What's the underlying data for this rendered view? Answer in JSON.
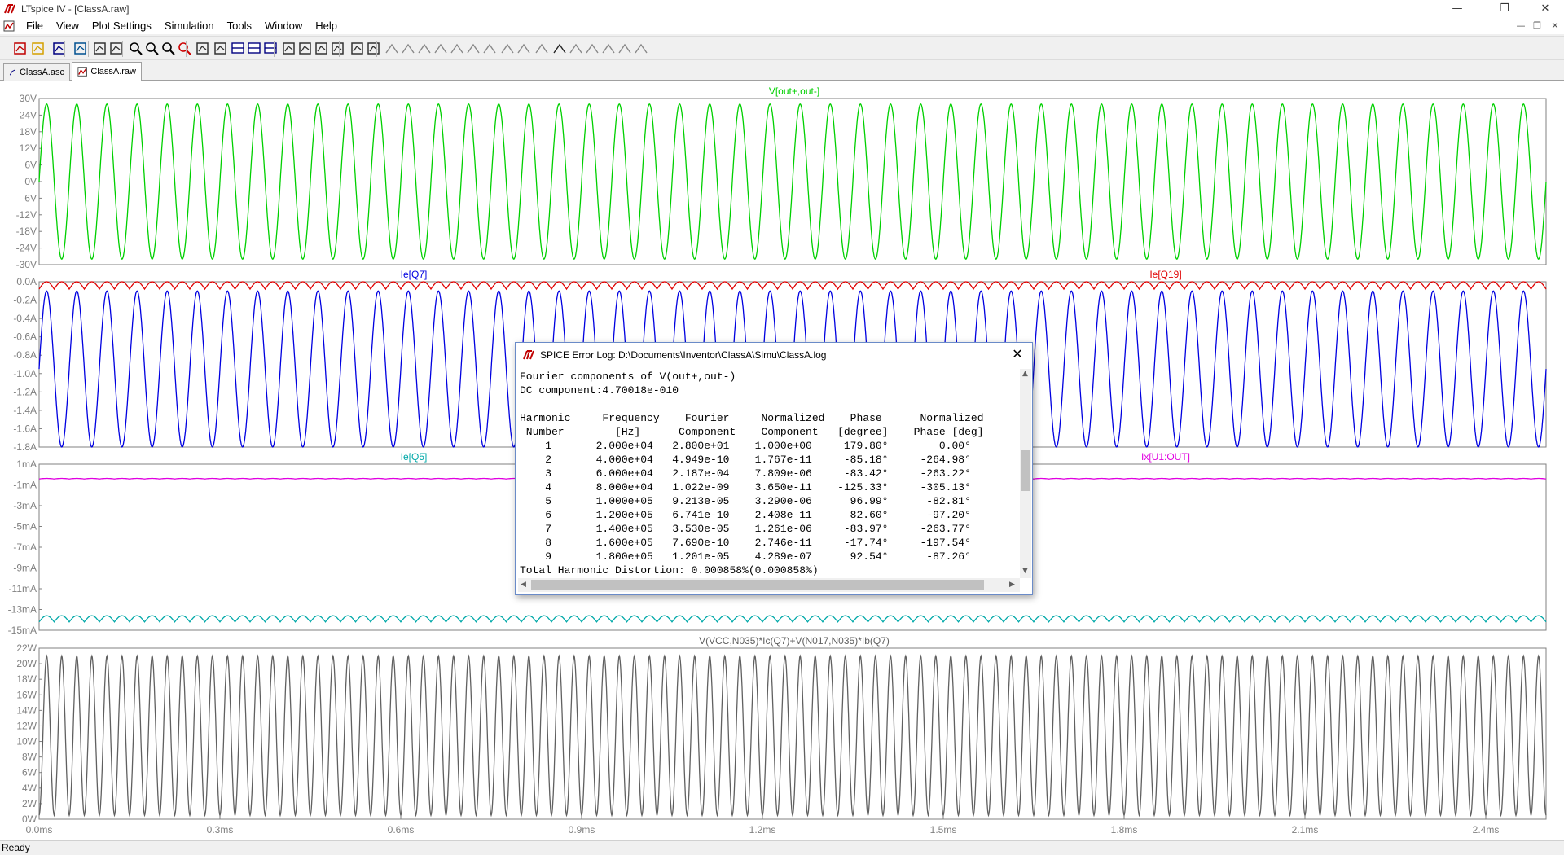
{
  "window": {
    "title": "LTspice IV - [ClassA.raw]"
  },
  "menu": [
    "File",
    "View",
    "Plot Settings",
    "Simulation",
    "Tools",
    "Window",
    "Help"
  ],
  "toolbar_icons": [
    "new-schematic-icon",
    "open-icon",
    "save-icon",
    "control-panel-icon",
    "run-icon",
    "halt-icon",
    "zoom-in-icon",
    "zoom-out-icon",
    "zoom-full-icon",
    "zoom-cancel-icon",
    "autorange-icon",
    "add-trace-icon",
    "tile-horizontal-icon",
    "tile-vertical-icon",
    "cascade-icon",
    "cut-icon",
    "copy-icon",
    "paste-icon",
    "find-icon",
    "print-preview-icon",
    "print-icon",
    "wire-icon",
    "ground-icon",
    "label-icon",
    "resistor-icon",
    "capacitor-icon",
    "inductor-icon",
    "diode-icon",
    "component-icon",
    "move-icon",
    "drag-icon",
    "undo-icon",
    "redo-icon",
    "rotate-icon",
    "mirror-icon",
    "text-icon",
    "spice-directive-icon"
  ],
  "tabs": [
    {
      "label": "ClassA.asc",
      "active": false
    },
    {
      "label": "ClassA.raw",
      "active": true
    }
  ],
  "chart_data": [
    {
      "type": "line",
      "series": [
        {
          "name": "V[out+,out-]",
          "color": "#00d000",
          "waveform": "sine",
          "amplitude": 28,
          "offset": 0,
          "frequency_hz": 20000
        }
      ],
      "yticks": [
        "30V",
        "24V",
        "18V",
        "12V",
        "6V",
        "0V",
        "-6V",
        "-12V",
        "-18V",
        "-24V",
        "-30V"
      ],
      "ylim": [
        -30,
        30
      ],
      "xlim": [
        0,
        2.5
      ],
      "grid": false
    },
    {
      "type": "line",
      "series": [
        {
          "name": "Ie[Q7]",
          "color": "#0000e0",
          "waveform": "sine",
          "amplitude": 0.85,
          "offset": -0.95,
          "frequency_hz": 20000
        },
        {
          "name": "Ie[Q19]",
          "color": "#e00000",
          "waveform": "rectified",
          "amplitude": 0.08,
          "offset": -0.04,
          "frequency_hz": 40000
        }
      ],
      "yticks": [
        "0.0A",
        "-0.2A",
        "-0.4A",
        "-0.6A",
        "-0.8A",
        "-1.0A",
        "-1.2A",
        "-1.4A",
        "-1.6A",
        "-1.8A"
      ],
      "ylim": [
        -1.8,
        0
      ],
      "xlim": [
        0,
        2.5
      ],
      "grid": false
    },
    {
      "type": "line",
      "series": [
        {
          "name": "Ie[Q5]",
          "color": "#00a8a8",
          "waveform": "ripple",
          "amplitude": 0.6,
          "offset": -13.9,
          "frequency_hz": 40000
        },
        {
          "name": "Ix[U1:OUT]",
          "color": "#e000e0",
          "waveform": "ripple",
          "amplitude": 0.05,
          "offset": -0.4,
          "frequency_hz": 40000
        }
      ],
      "yticks": [
        "1mA",
        "-1mA",
        "-3mA",
        "-5mA",
        "-7mA",
        "-9mA",
        "-11mA",
        "-13mA",
        "-15mA"
      ],
      "ylim": [
        -15,
        1
      ],
      "xlim": [
        0,
        2.5
      ],
      "grid": false
    },
    {
      "type": "line",
      "series": [
        {
          "name": "V(VCC,N035)*Ic(Q7)+V(N017,N035)*Ib(Q7)",
          "color": "#606060",
          "waveform": "power",
          "amplitude": 20.5,
          "offset": 0.5,
          "frequency_hz": 20000
        }
      ],
      "yticks": [
        "22W",
        "20W",
        "18W",
        "16W",
        "14W",
        "12W",
        "10W",
        "8W",
        "6W",
        "4W",
        "2W",
        "0W"
      ],
      "ylim": [
        0,
        22
      ],
      "xlim": [
        0,
        2.5
      ],
      "xticks": [
        "0.0ms",
        "0.3ms",
        "0.6ms",
        "0.9ms",
        "1.2ms",
        "1.5ms",
        "1.8ms",
        "2.1ms",
        "2.4ms"
      ],
      "grid": false
    }
  ],
  "dialog": {
    "title": "SPICE Error Log: D:\\Documents\\Inventor\\ClassA\\Simu\\ClassA.log",
    "lines": [
      "Fourier components of V(out+,out-)",
      "DC component:4.70018e-010",
      "",
      "Harmonic     Frequency    Fourier     Normalized    Phase      Normalized",
      " Number        [Hz]      Component    Component   [degree]    Phase [deg]",
      "    1       2.000e+04   2.800e+01    1.000e+00     179.80°        0.00°",
      "    2       4.000e+04   4.949e-10    1.767e-11     -85.18°     -264.98°",
      "    3       6.000e+04   2.187e-04    7.809e-06     -83.42°     -263.22°",
      "    4       8.000e+04   1.022e-09    3.650e-11    -125.33°     -305.13°",
      "    5       1.000e+05   9.213e-05    3.290e-06      96.99°      -82.81°",
      "    6       1.200e+05   6.741e-10    2.408e-11      82.60°      -97.20°",
      "    7       1.400e+05   3.530e-05    1.261e-06     -83.97°     -263.77°",
      "    8       1.600e+05   7.690e-10    2.746e-11     -17.74°     -197.54°",
      "    9       1.800e+05   1.201e-05    4.289e-07      92.54°      -87.26°",
      "Total Harmonic Distortion: 0.000858%(0.000858%)"
    ]
  },
  "status": {
    "text": "Ready"
  }
}
